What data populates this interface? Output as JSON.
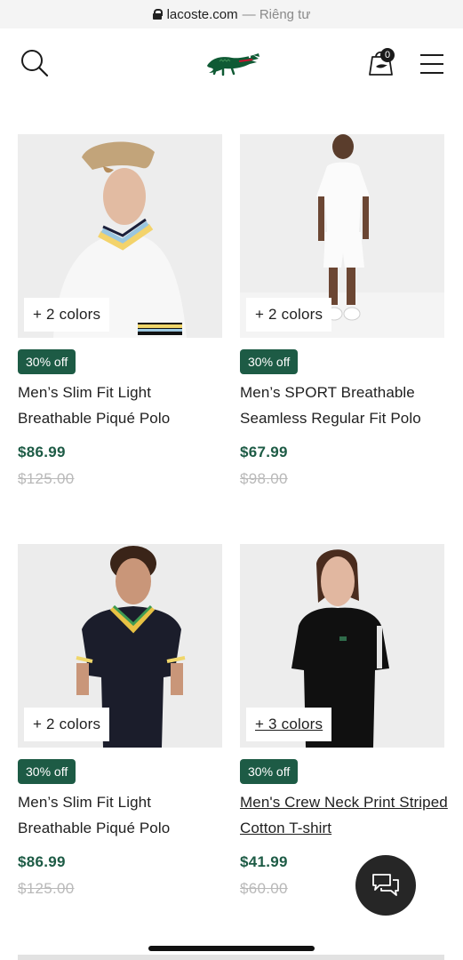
{
  "browser": {
    "domain": "lacoste.com",
    "separator": "—",
    "mode": "Riêng tư"
  },
  "header": {
    "search_icon": "search-icon",
    "logo": "lacoste-crocodile-logo",
    "cart_icon": "shopping-bag-icon",
    "cart_count": "0",
    "menu_icon": "hamburger-menu-icon"
  },
  "products": [
    {
      "colors": "+ 2 colors",
      "discount": "30% off",
      "title": "Men’s Slim Fit Light Breathable Piqué Polo",
      "price": "$86.99",
      "old_price": "$125.00"
    },
    {
      "colors": "+ 2 colors",
      "discount": "30% off",
      "title": "Men’s SPORT Breathable Seamless Regular Fit Polo",
      "price": "$67.99",
      "old_price": "$98.00"
    },
    {
      "colors": "+ 2 colors",
      "discount": "30% off",
      "title": "Men’s Slim Fit Light Breathable Piqué Polo",
      "price": "$86.99",
      "old_price": "$125.00"
    },
    {
      "colors": "+ 3 colors",
      "discount": "30% off",
      "title": "Men's Crew Neck Print Striped Cotton T-shirt",
      "price": "$41.99",
      "old_price": "$60.00"
    }
  ],
  "chat": {
    "icon": "chat-bubbles-icon"
  },
  "colors": {
    "brand_green": "#1d5b45",
    "strike_grey": "#b9b9b9",
    "chat_bg": "#262626"
  }
}
